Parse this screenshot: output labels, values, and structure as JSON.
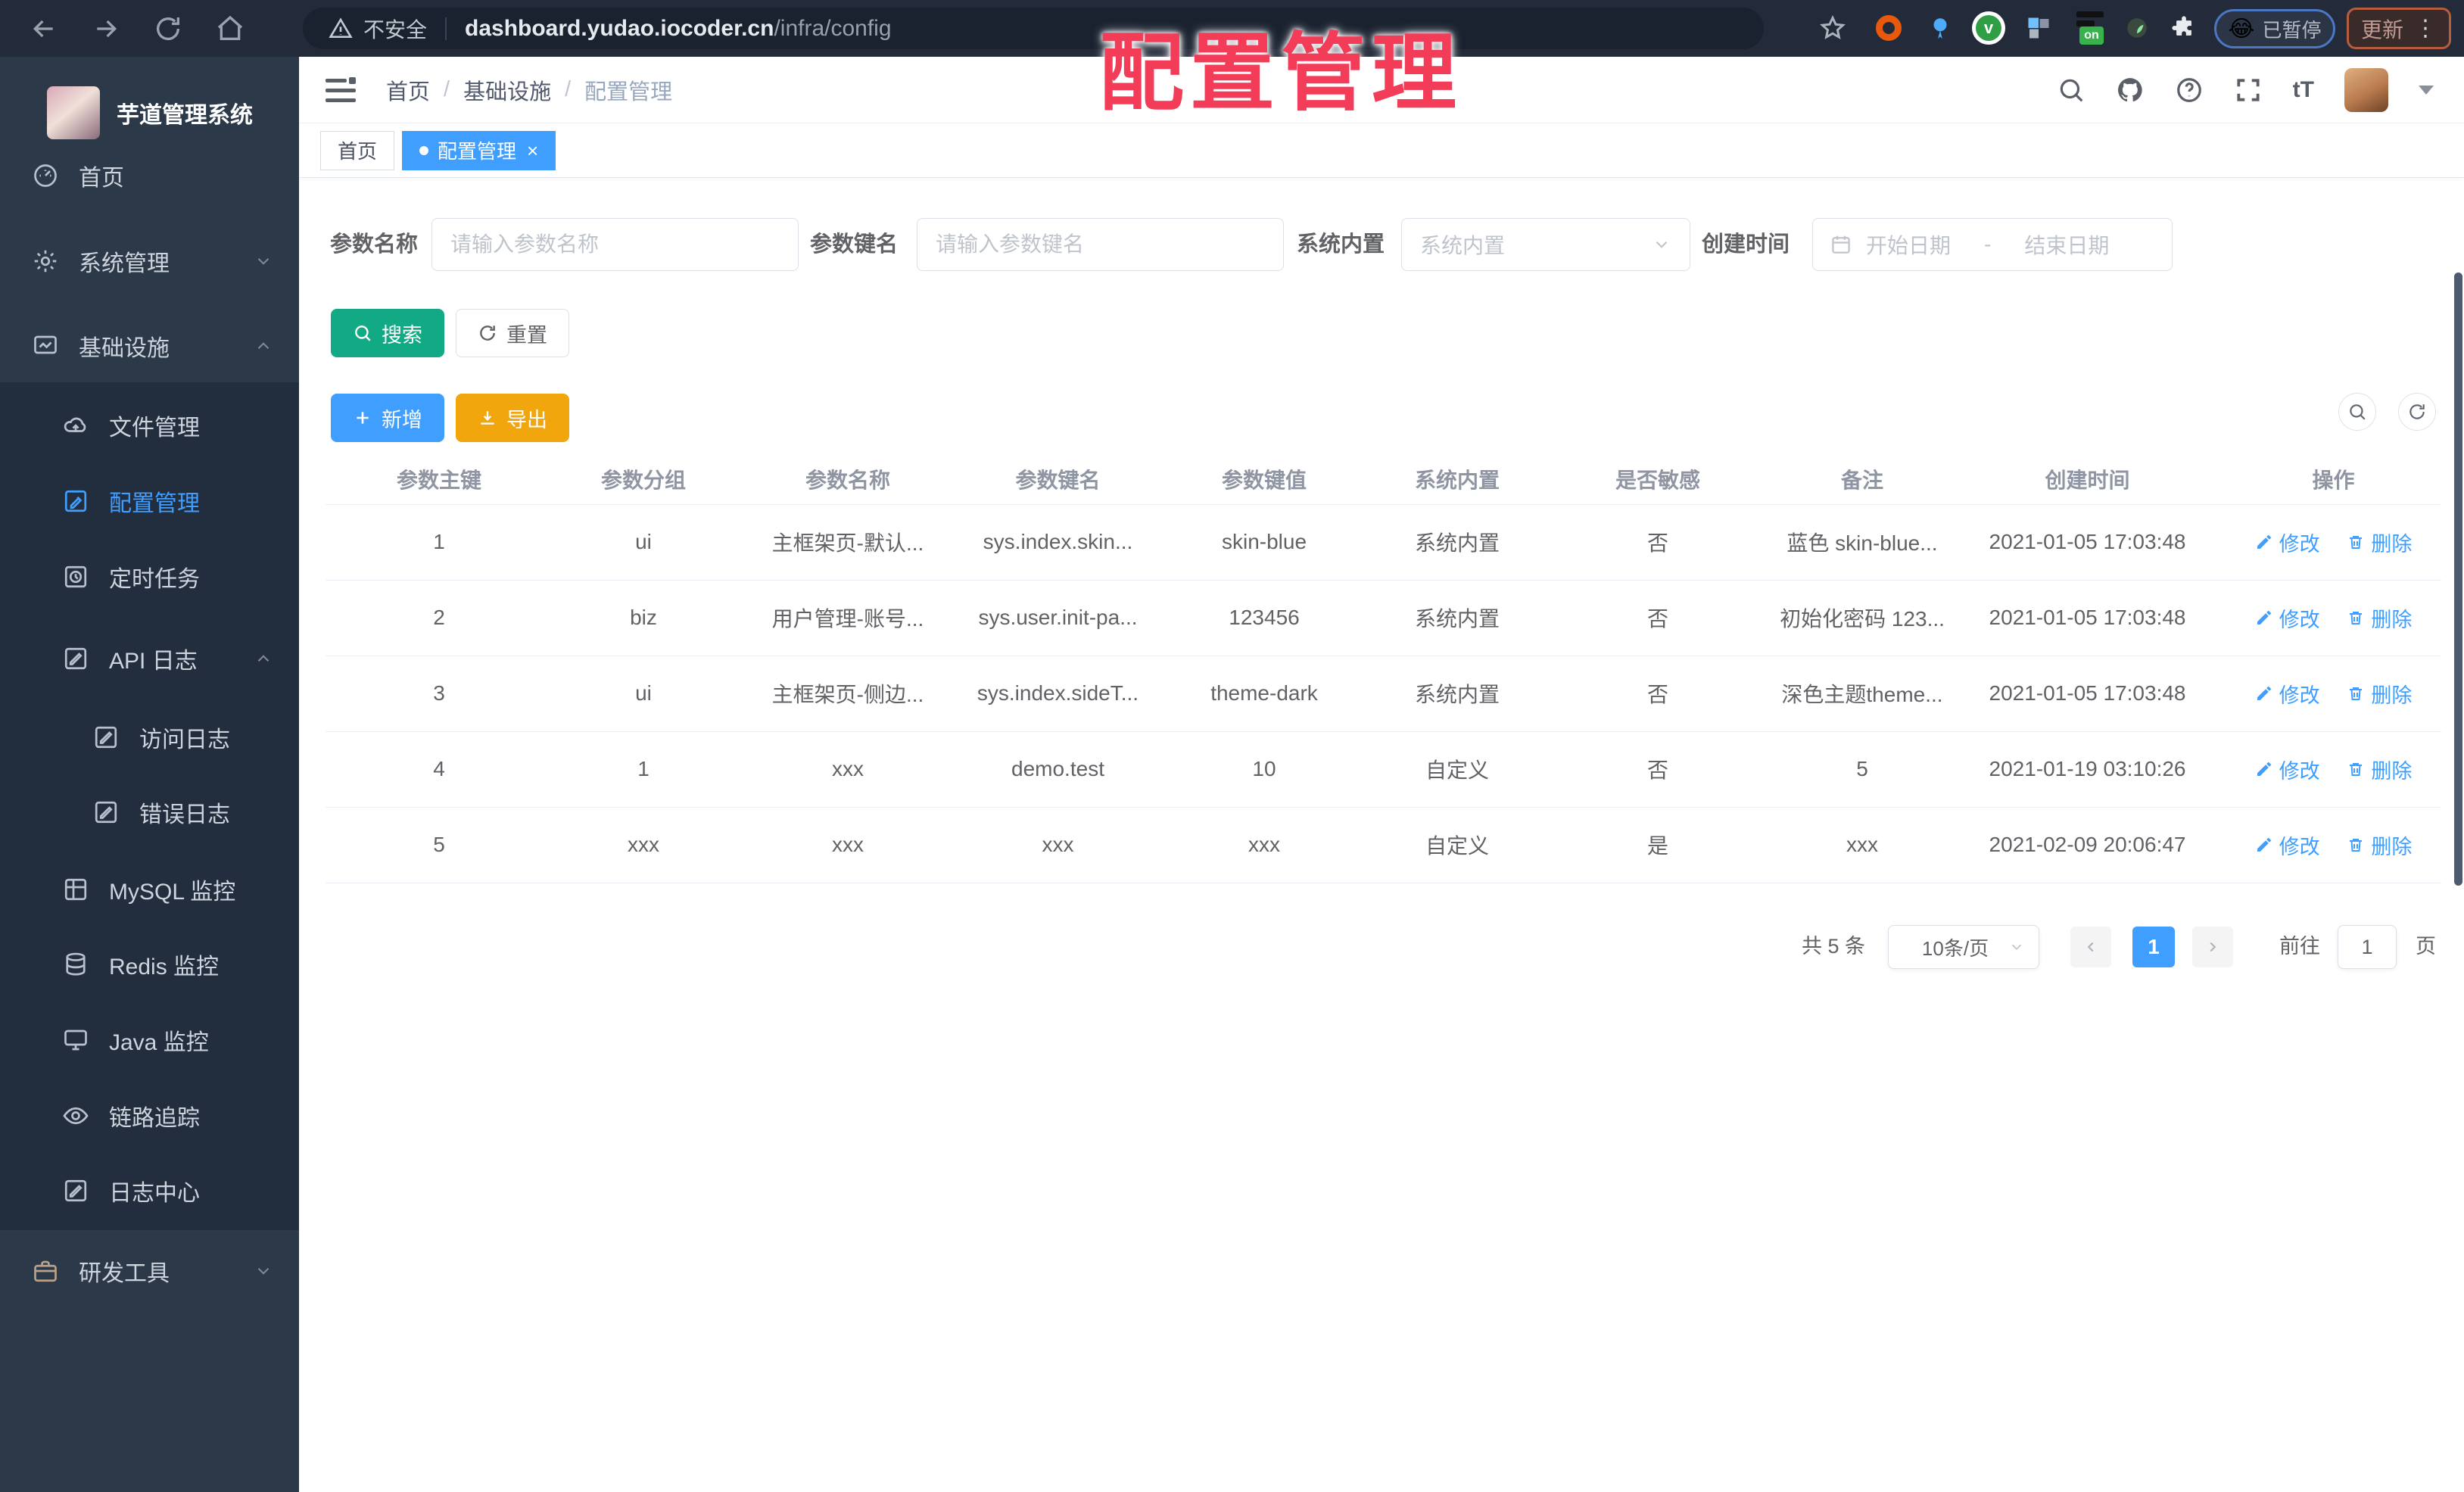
{
  "browser": {
    "security_label": "不安全",
    "url_host": "dashboard.yudao.iocoder.cn",
    "url_path": "/infra/config",
    "on_badge": "on",
    "paused_label": "已暂停",
    "update_label": "更新"
  },
  "overlay_title": "配置管理",
  "sidebar": {
    "app_title": "芋道管理系统",
    "items": [
      {
        "label": "首页"
      },
      {
        "label": "系统管理"
      },
      {
        "label": "基础设施"
      },
      {
        "label": "文件管理"
      },
      {
        "label": "配置管理"
      },
      {
        "label": "定时任务"
      },
      {
        "label": "API 日志"
      },
      {
        "label": "访问日志"
      },
      {
        "label": "错误日志"
      },
      {
        "label": "MySQL 监控"
      },
      {
        "label": "Redis 监控"
      },
      {
        "label": "Java 监控"
      },
      {
        "label": "链路追踪"
      },
      {
        "label": "日志中心"
      },
      {
        "label": "研发工具"
      }
    ]
  },
  "header": {
    "breadcrumb": [
      "首页",
      "基础设施",
      "配置管理"
    ],
    "separator": "/"
  },
  "tabs": [
    {
      "label": "首页"
    },
    {
      "label": "配置管理"
    }
  ],
  "filters": {
    "param_name_label": "参数名称",
    "param_name_placeholder": "请输入参数名称",
    "param_key_label": "参数键名",
    "param_key_placeholder": "请输入参数键名",
    "builtin_label": "系统内置",
    "builtin_placeholder": "系统内置",
    "create_time_label": "创建时间",
    "start_placeholder": "开始日期",
    "range_separator": "-",
    "end_placeholder": "结束日期"
  },
  "toolbar": {
    "search_label": "搜索",
    "reset_label": "重置",
    "add_label": "新增",
    "export_label": "导出"
  },
  "table": {
    "columns": [
      "参数主键",
      "参数分组",
      "参数名称",
      "参数键名",
      "参数键值",
      "系统内置",
      "是否敏感",
      "备注",
      "创建时间",
      "操作"
    ],
    "edit_label": "修改",
    "delete_label": "删除",
    "rows": [
      {
        "id": "1",
        "group": "ui",
        "name": "主框架页-默认...",
        "key": "sys.index.skin...",
        "value": "skin-blue",
        "builtin": "系统内置",
        "sensitive": "否",
        "remark": "蓝色 skin-blue...",
        "created": "2021-01-05 17:03:48"
      },
      {
        "id": "2",
        "group": "biz",
        "name": "用户管理-账号...",
        "key": "sys.user.init-pa...",
        "value": "123456",
        "builtin": "系统内置",
        "sensitive": "否",
        "remark": "初始化密码 123...",
        "created": "2021-01-05 17:03:48"
      },
      {
        "id": "3",
        "group": "ui",
        "name": "主框架页-侧边...",
        "key": "sys.index.sideT...",
        "value": "theme-dark",
        "builtin": "系统内置",
        "sensitive": "否",
        "remark": "深色主题theme...",
        "created": "2021-01-05 17:03:48"
      },
      {
        "id": "4",
        "group": "1",
        "name": "xxx",
        "key": "demo.test",
        "value": "10",
        "builtin": "自定义",
        "sensitive": "否",
        "remark": "5",
        "created": "2021-01-19 03:10:26"
      },
      {
        "id": "5",
        "group": "xxx",
        "name": "xxx",
        "key": "xxx",
        "value": "xxx",
        "builtin": "自定义",
        "sensitive": "是",
        "remark": "xxx",
        "created": "2021-02-09 20:06:47"
      }
    ]
  },
  "pagination": {
    "total": "共 5 条",
    "page_size": "10条/页",
    "current_page": "1",
    "goto_label": "前往",
    "goto_value": "1",
    "page_unit": "页"
  },
  "colors": {
    "accent_blue": "#409eff",
    "search_teal": "#12a985",
    "export_orange": "#f2a60d",
    "overlay_red": "#f33c58",
    "sidebar_bg": "#2c3949",
    "submenu_bg": "#222d3d",
    "browser_bg": "#232b3a"
  }
}
